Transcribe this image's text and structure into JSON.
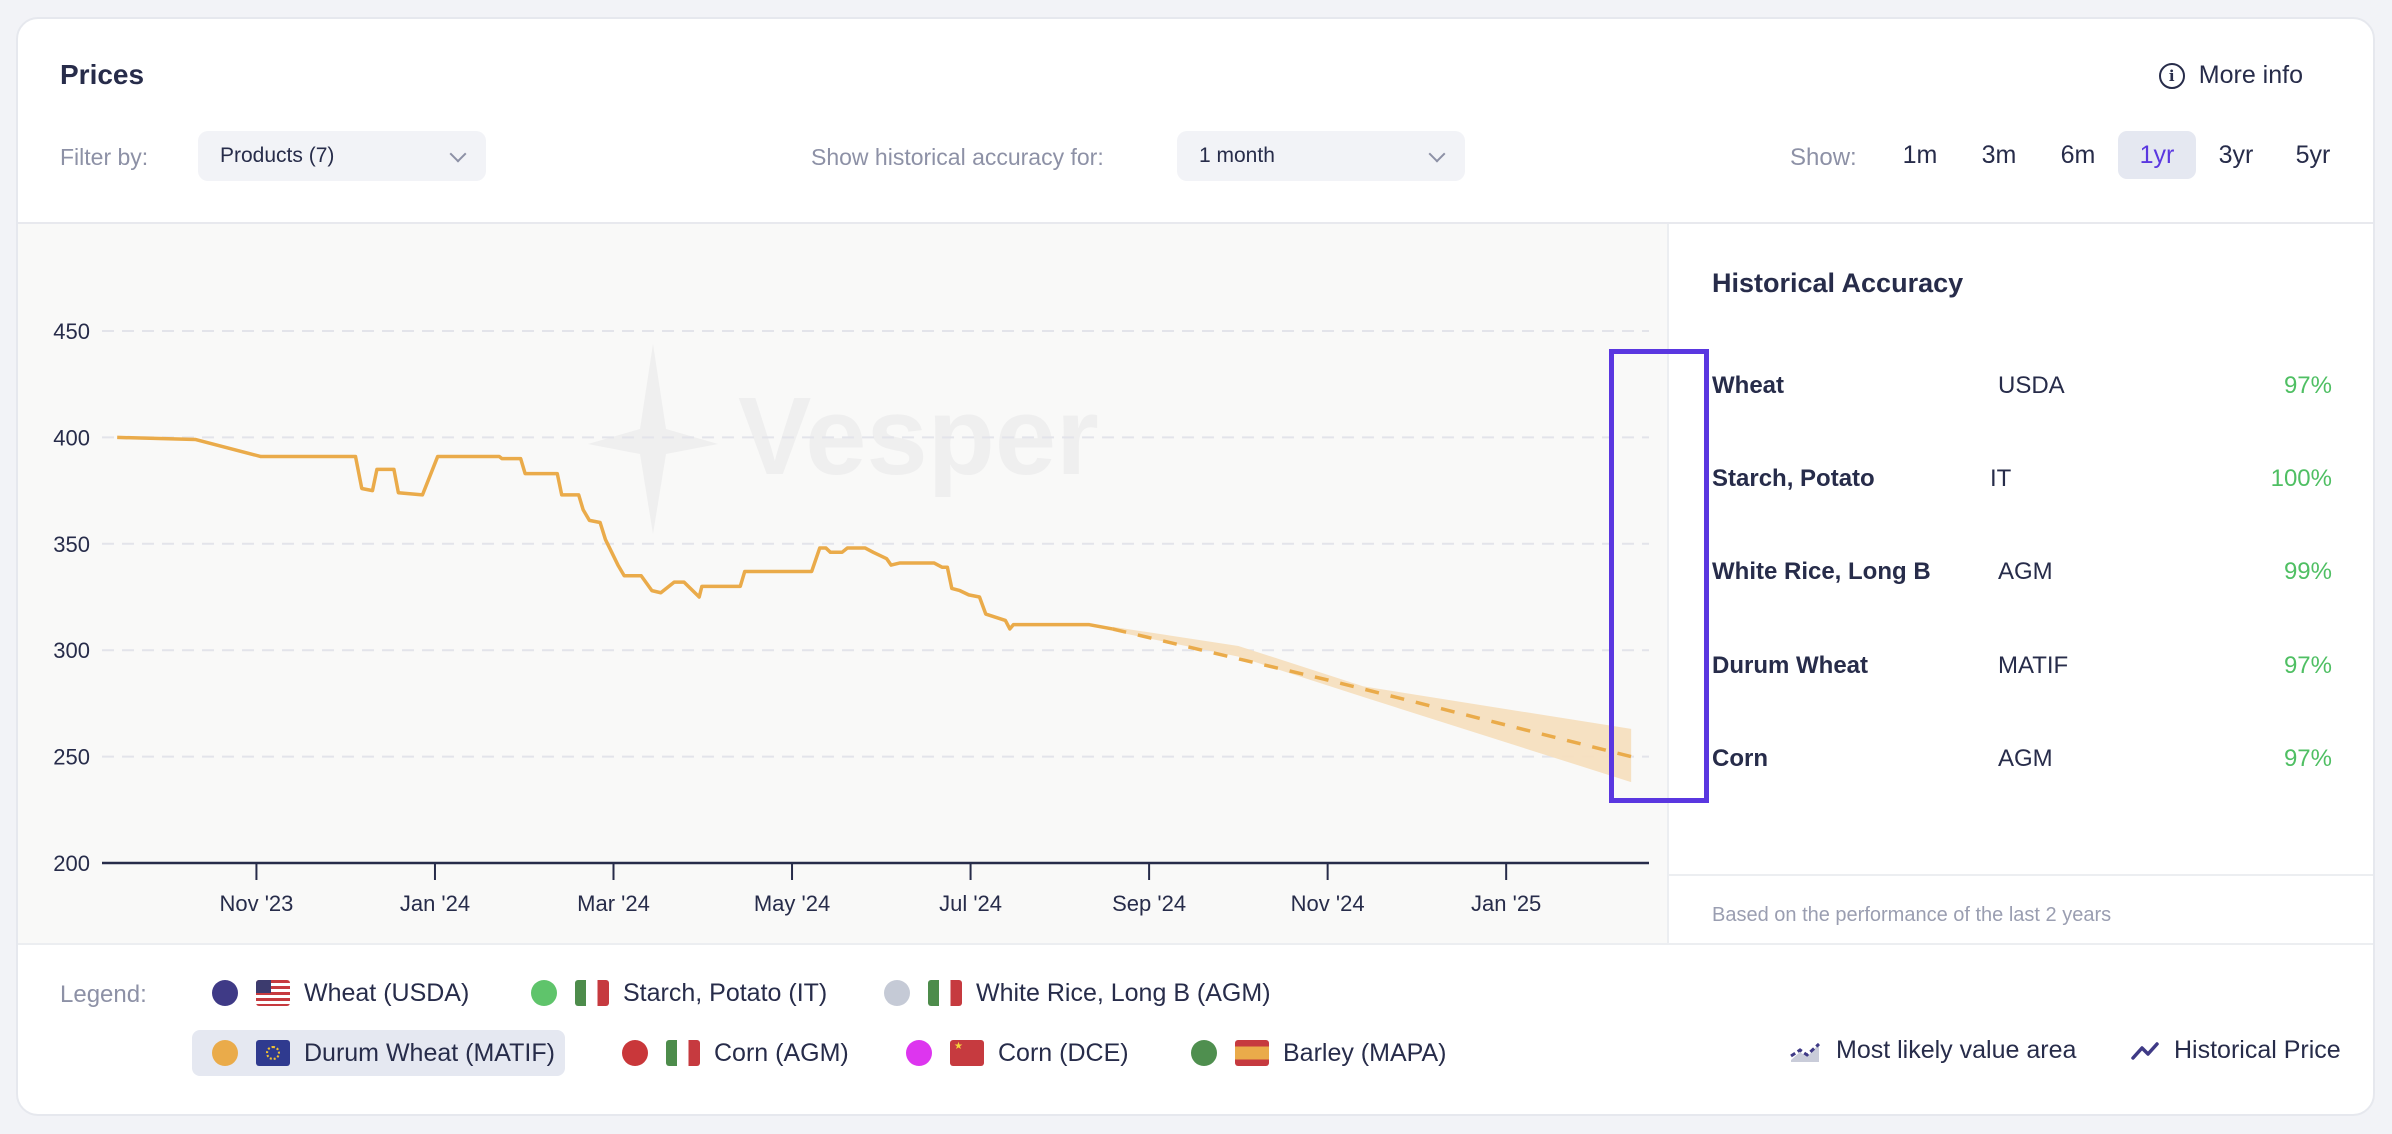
{
  "header": {
    "title": "Prices",
    "more_info_label": "More info",
    "filter_label": "Filter by:",
    "filter_value": "Products (7)",
    "accuracy_label": "Show historical accuracy for:",
    "accuracy_value": "1 month",
    "show_label": "Show:",
    "ranges": [
      {
        "label": "1m",
        "active": false
      },
      {
        "label": "3m",
        "active": false
      },
      {
        "label": "6m",
        "active": false
      },
      {
        "label": "1yr",
        "active": true
      },
      {
        "label": "3yr",
        "active": false
      },
      {
        "label": "5yr",
        "active": false
      }
    ]
  },
  "watermark": "Vesper",
  "historical_accuracy": {
    "title": "Historical Accuracy",
    "rows": [
      {
        "name": "Wheat",
        "source": "USDA",
        "value": "97%"
      },
      {
        "name": "Starch, Potato",
        "source": "IT",
        "value": "100%"
      },
      {
        "name": "White Rice, Long B",
        "source": "AGM",
        "value": "99%"
      },
      {
        "name": "Durum Wheat",
        "source": "MATIF",
        "value": "97%"
      },
      {
        "name": "Corn",
        "source": "AGM",
        "value": "97%"
      }
    ],
    "footnote": "Based on the performance of the last 2 years"
  },
  "legend": {
    "label": "Legend:",
    "items": [
      {
        "label": "Wheat (USDA)",
        "color": "#3f3a86",
        "flag": "us",
        "active": false
      },
      {
        "label": "Starch, Potato (IT)",
        "color": "#5fc46b",
        "flag": "it",
        "active": false
      },
      {
        "label": "White Rice, Long B (AGM)",
        "color": "#c5cad6",
        "flag": "it",
        "active": false
      },
      {
        "label": "Durum Wheat (MATIF)",
        "color": "#eaab4a",
        "flag": "eu",
        "active": true
      },
      {
        "label": "Corn (AGM)",
        "color": "#c9373a",
        "flag": "it",
        "active": false
      },
      {
        "label": "Corn (DCE)",
        "color": "#dd35ef",
        "flag": "cn",
        "active": false
      },
      {
        "label": "Barley (MAPA)",
        "color": "#4f8f4f",
        "flag": "es",
        "active": false
      }
    ],
    "keys": [
      {
        "label": "Most likely value area",
        "icon": "area-chart-icon"
      },
      {
        "label": "Historical Price",
        "icon": "line-chart-icon"
      }
    ]
  },
  "chart_data": {
    "type": "line",
    "title": "",
    "xlabel": "",
    "ylabel": "",
    "x_unit": "months since Nov 2023 (0 = Nov '23)",
    "x_ticks": [
      {
        "x": 0,
        "label": "Nov '23"
      },
      {
        "x": 2,
        "label": "Jan '24"
      },
      {
        "x": 4,
        "label": "Mar '24"
      },
      {
        "x": 6,
        "label": "May '24"
      },
      {
        "x": 8,
        "label": "Jul '24"
      },
      {
        "x": 10,
        "label": "Sep '24"
      },
      {
        "x": 12,
        "label": "Nov '24"
      },
      {
        "x": 14,
        "label": "Jan '25"
      }
    ],
    "xlim": [
      -1.73,
      15.6
    ],
    "y_ticks": [
      200,
      250,
      300,
      350,
      400,
      450
    ],
    "ylim": [
      200,
      475
    ],
    "grid": true,
    "series": [
      {
        "name": "Durum Wheat (MATIF) — Historical Price",
        "color": "#eaab4a",
        "style": "solid",
        "points": [
          [
            -1.56,
            400
          ],
          [
            -0.68,
            399
          ],
          [
            0.05,
            391
          ],
          [
            1.11,
            391
          ],
          [
            1.18,
            376
          ],
          [
            1.3,
            375
          ],
          [
            1.35,
            385
          ],
          [
            1.54,
            385
          ],
          [
            1.59,
            374
          ],
          [
            1.86,
            373
          ],
          [
            2.03,
            391
          ],
          [
            2.72,
            391
          ],
          [
            2.75,
            390
          ],
          [
            2.96,
            390
          ],
          [
            3.01,
            383
          ],
          [
            3.37,
            383
          ],
          [
            3.42,
            373
          ],
          [
            3.61,
            373
          ],
          [
            3.66,
            366
          ],
          [
            3.73,
            361
          ],
          [
            3.85,
            360
          ],
          [
            3.91,
            352
          ],
          [
            4.05,
            340
          ],
          [
            4.12,
            335
          ],
          [
            4.31,
            335
          ],
          [
            4.43,
            328
          ],
          [
            4.53,
            327
          ],
          [
            4.68,
            332
          ],
          [
            4.79,
            332
          ],
          [
            4.96,
            325
          ],
          [
            4.99,
            330
          ],
          [
            5.42,
            330
          ],
          [
            5.47,
            337
          ],
          [
            6.22,
            337
          ],
          [
            6.31,
            348
          ],
          [
            6.38,
            348
          ],
          [
            6.43,
            346
          ],
          [
            6.56,
            346
          ],
          [
            6.62,
            348
          ],
          [
            6.82,
            348
          ],
          [
            6.91,
            346
          ],
          [
            7.06,
            343
          ],
          [
            7.11,
            340
          ],
          [
            7.21,
            341
          ],
          [
            7.59,
            341
          ],
          [
            7.68,
            339
          ],
          [
            7.74,
            339
          ],
          [
            7.79,
            329
          ],
          [
            7.88,
            328
          ],
          [
            7.98,
            326
          ],
          [
            8.1,
            325
          ],
          [
            8.17,
            317
          ],
          [
            8.39,
            314
          ],
          [
            8.44,
            310
          ],
          [
            8.48,
            312
          ],
          [
            9.33,
            312
          ],
          [
            9.59,
            310
          ]
        ]
      },
      {
        "name": "Durum Wheat (MATIF) — Forecast",
        "color": "#eaab4a",
        "style": "dashed",
        "points": [
          [
            9.59,
            310
          ],
          [
            12.0,
            286
          ],
          [
            15.4,
            250
          ]
        ]
      }
    ],
    "band": {
      "name": "Most likely value area",
      "color": "#f5dfbf",
      "upper": [
        [
          9.59,
          311
        ],
        [
          11.0,
          302
        ],
        [
          12.4,
          283
        ],
        [
          15.4,
          263
        ]
      ],
      "lower": [
        [
          9.59,
          309
        ],
        [
          11.0,
          297
        ],
        [
          12.4,
          278
        ],
        [
          15.4,
          238
        ]
      ]
    }
  }
}
